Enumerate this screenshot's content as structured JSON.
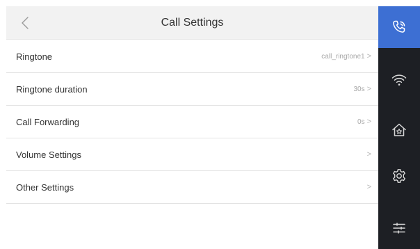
{
  "header": {
    "title": "Call Settings",
    "back_icon": "chevron-left-icon"
  },
  "settings": [
    {
      "label": "Ringtone",
      "value": "call_ringtone1",
      "chevron": ">"
    },
    {
      "label": "Ringtone duration",
      "value": "30s",
      "chevron": ">"
    },
    {
      "label": "Call Forwarding",
      "value": "0s",
      "chevron": ">"
    },
    {
      "label": "Volume Settings",
      "value": "",
      "chevron": ">"
    },
    {
      "label": "Other Settings",
      "value": "",
      "chevron": ">"
    }
  ],
  "sidebar": {
    "items": [
      {
        "icon": "phone-icon",
        "active": true
      },
      {
        "icon": "wifi-icon",
        "active": false
      },
      {
        "icon": "home-icon",
        "active": false
      },
      {
        "icon": "gear-icon",
        "active": false
      },
      {
        "icon": "menu-icon",
        "active": false
      }
    ]
  },
  "colors": {
    "accent": "#3d6fd3",
    "sidebar_bg": "#1d1f24",
    "header_bg": "#f2f2f2"
  }
}
